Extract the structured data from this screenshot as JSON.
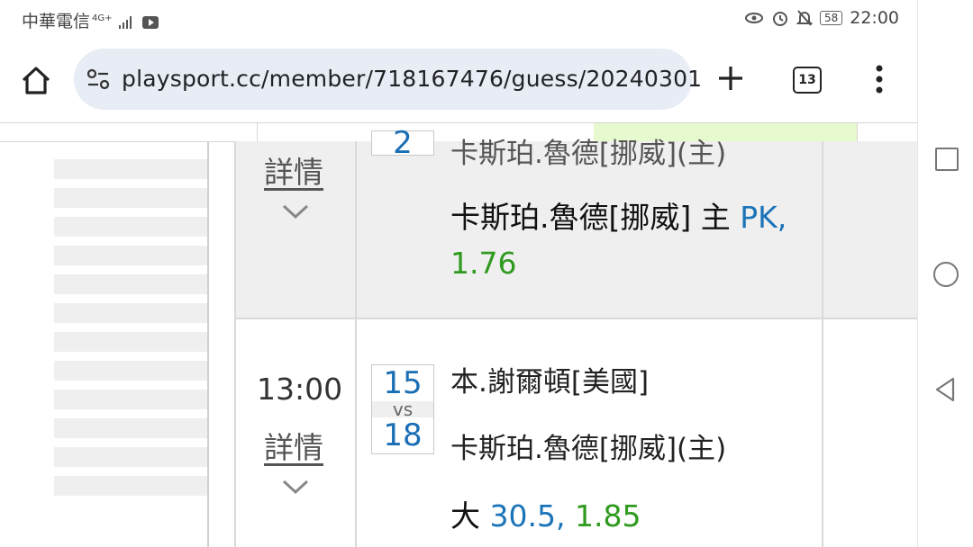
{
  "status_bar": {
    "carrier": "中華電信",
    "network": "4G+",
    "battery": "58",
    "time": "22:00"
  },
  "browser": {
    "url": "playsport.cc/member/718167476/guess/20240301",
    "tab_count": "13"
  },
  "games": [
    {
      "time": "",
      "detail_label": "詳情",
      "score_home_partial": "2",
      "home_team_partial": "卡斯珀.魯德[挪威](主)",
      "pick_team": "卡斯珀.魯德[挪威] 主",
      "pick_handicap": "PK,",
      "pick_odds": "1.76"
    },
    {
      "time": "13:00",
      "detail_label": "詳情",
      "score_away": "15",
      "vs_label": "vs",
      "score_home": "18",
      "away_team": "本.謝爾頓[美國]",
      "home_team": "卡斯珀.魯德[挪威](主)",
      "pick_prefix": "大",
      "pick_line": "30.5,",
      "pick_odds": "1.85"
    }
  ],
  "colors": {
    "link_blue": "#1a73b8",
    "odds_green": "#2f9a1e",
    "highlight_green": "#e7f9cf"
  }
}
